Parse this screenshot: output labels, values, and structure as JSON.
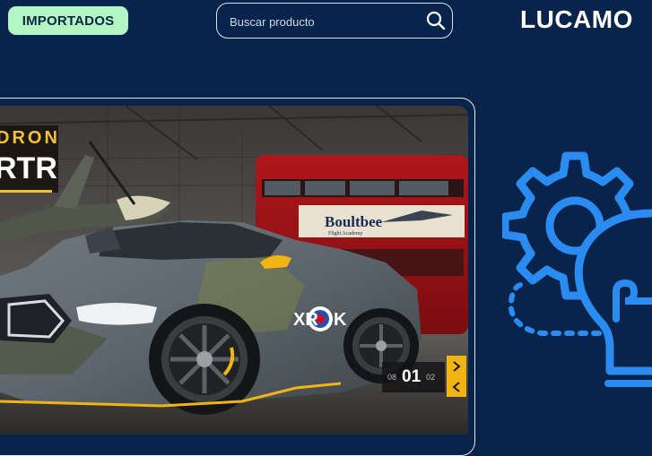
{
  "header": {
    "imported_button": "IMPORTADOS",
    "search": {
      "placeholder": "Buscar producto",
      "value": ""
    },
    "brand": "LUCAMO"
  },
  "slider": {
    "banner_line1": "DRON",
    "banner_line2": "RTR",
    "hangar_sign": "Boultbee",
    "hangar_sign_sub": "Flight Academy",
    "car_decal": "XR",
    "car_decal_end": "K",
    "counter": {
      "prev": "08",
      "current": "01",
      "next": "02"
    }
  },
  "icons": {
    "search": "search-icon",
    "next": "chevron-right-icon",
    "prev": "chevron-left-icon",
    "illustration": "gear-lightbulb-icon"
  },
  "colors": {
    "background": "#08244a",
    "button_bg": "#b2f7c3",
    "accent_yellow": "#f1b412",
    "illustration_blue": "#2a8cf0"
  }
}
